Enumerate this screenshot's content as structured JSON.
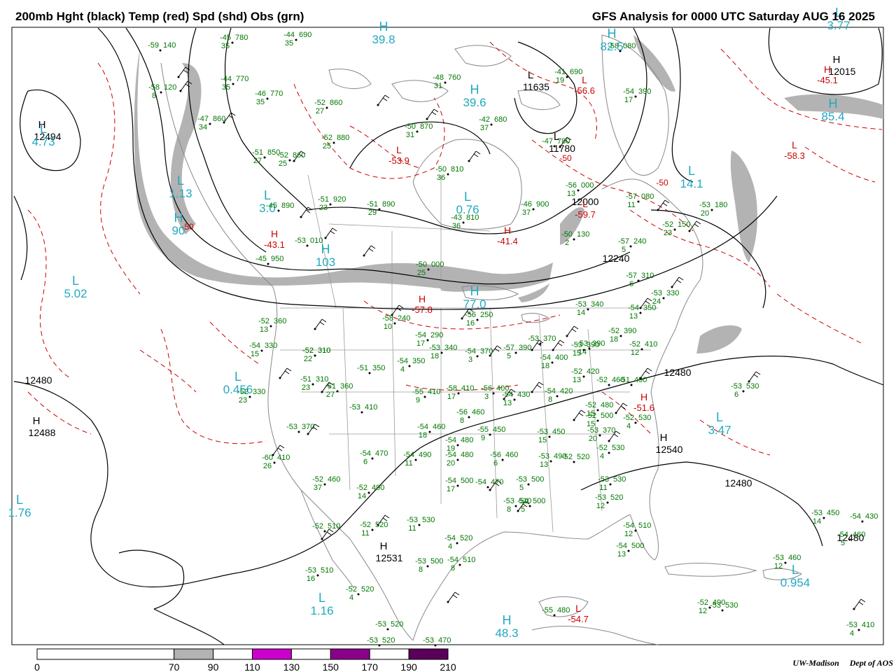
{
  "header": {
    "left_title": "200mb Hght (black) Temp (red) Spd (shd) Obs (grn)",
    "right_title": "GFS Analysis for 0000 UTC Saturday  AUG 16 2025"
  },
  "credit": {
    "left": "UW-Madison",
    "right": "Dept of AOS"
  },
  "colors": {
    "height_contour": "#000000",
    "temperature": "#cc0000",
    "observations": "#007700",
    "speed_label": "#22a9c0",
    "geography": "#888888",
    "shade_70_90": "#b3b3b3",
    "shade_110_130": "#cc00cc",
    "shade_150_170": "#8b008b",
    "shade_190_210": "#5a005a"
  },
  "colorbar": {
    "ticks": [
      "0",
      "70",
      "90",
      "110",
      "130",
      "150",
      "170",
      "190",
      "210"
    ],
    "segments": [
      {
        "from": 0,
        "to": 70,
        "color": "#ffffff"
      },
      {
        "from": 70,
        "to": 90,
        "color": "#b3b3b3"
      },
      {
        "from": 90,
        "to": 110,
        "color": "#ffffff"
      },
      {
        "from": 110,
        "to": 130,
        "color": "#cc00cc"
      },
      {
        "from": 130,
        "to": 150,
        "color": "#ffffff"
      },
      {
        "from": 150,
        "to": 170,
        "color": "#8b008b"
      },
      {
        "from": 170,
        "to": 190,
        "color": "#ffffff"
      },
      {
        "from": 190,
        "to": 210,
        "color": "#5a005a"
      }
    ]
  },
  "height_centers": [
    {
      "type": "H",
      "value": "12494"
    },
    {
      "type": "H",
      "value": "12488"
    },
    {
      "type": "H",
      "value": "12531"
    },
    {
      "type": "H",
      "value": "12540"
    },
    {
      "type": "H",
      "value": "12015"
    },
    {
      "type": "L",
      "value": "11635"
    },
    {
      "type": "L",
      "value": "11780"
    }
  ],
  "contour_labels": [
    "12480",
    "12480",
    "12480",
    "12240",
    "12000",
    "12480"
  ],
  "temp_centers": [
    {
      "type": "L",
      "value": "-53.9"
    },
    {
      "type": "L",
      "value": "-59.7"
    },
    {
      "type": "L",
      "value": "-56.6"
    },
    {
      "type": "L",
      "value": "-58.3"
    },
    {
      "type": "H",
      "value": "-43.1"
    },
    {
      "type": "H",
      "value": "-41.4"
    },
    {
      "type": "H",
      "value": "-45.1"
    },
    {
      "type": "H",
      "value": "-57.8"
    },
    {
      "type": "H",
      "value": "-51.6"
    },
    {
      "type": "L",
      "value": "-54.7"
    }
  ],
  "temp_contour_labels": [
    "-50",
    "-50",
    "-50"
  ],
  "speed_centers": [
    {
      "type": "L",
      "value": "4.73"
    },
    {
      "type": "L",
      "value": "5.02"
    },
    {
      "type": "L",
      "value": "0.456"
    },
    {
      "type": "L",
      "value": "1.16"
    },
    {
      "type": "L",
      "value": "3.47"
    },
    {
      "type": "L",
      "value": "14.1"
    },
    {
      "type": "L",
      "value": "0.954"
    },
    {
      "type": "H",
      "value": "39.8"
    },
    {
      "type": "H",
      "value": "39.6"
    },
    {
      "type": "H",
      "value": "82.5"
    },
    {
      "type": "H",
      "value": "85.4"
    },
    {
      "type": "H",
      "value": "77.0"
    },
    {
      "type": "H",
      "value": "48.3"
    },
    {
      "type": "H",
      "value": "90"
    },
    {
      "type": "L",
      "value": "3.77"
    },
    {
      "type": "L",
      "value": "1.76"
    },
    {
      "type": "L",
      "value": "1.13"
    },
    {
      "type": "L",
      "value": "3.0"
    },
    {
      "type": "L",
      "value": "0.76"
    },
    {
      "type": "H",
      "value": "103"
    }
  ],
  "observations": [
    {
      "temp": "-52",
      "hgt": "360",
      "spd": "13"
    },
    {
      "temp": "-54",
      "hgt": "330",
      "spd": "15"
    },
    {
      "temp": "-52",
      "hgt": "310",
      "spd": "22"
    },
    {
      "temp": "-52",
      "hgt": "310",
      "spd": ""
    },
    {
      "temp": "-51",
      "hgt": "310",
      "spd": "23"
    },
    {
      "temp": "-51",
      "hgt": "360",
      "spd": "27"
    },
    {
      "temp": "-52",
      "hgt": "330",
      "spd": "23"
    },
    {
      "temp": "-53",
      "hgt": "370",
      "spd": ""
    },
    {
      "temp": "-60",
      "hgt": "410",
      "spd": "26"
    },
    {
      "temp": "-52",
      "hgt": "460",
      "spd": "37"
    },
    {
      "temp": "-52",
      "hgt": "490",
      "spd": "14"
    },
    {
      "temp": "-52",
      "hgt": "510",
      "spd": ""
    },
    {
      "temp": "-53",
      "hgt": "510",
      "spd": "16"
    },
    {
      "temp": "-52",
      "hgt": "520",
      "spd": "4"
    },
    {
      "temp": "-53",
      "hgt": "520",
      "spd": ""
    },
    {
      "temp": "-52",
      "hgt": "520",
      "spd": "11"
    },
    {
      "temp": "-53",
      "hgt": "530",
      "spd": "11"
    },
    {
      "temp": "-54",
      "hgt": "520",
      "spd": "4"
    },
    {
      "temp": "-53",
      "hgt": "500",
      "spd": "8"
    },
    {
      "temp": "-54",
      "hgt": "510",
      "spd": "8"
    },
    {
      "temp": "-54",
      "hgt": "470",
      "spd": "6"
    },
    {
      "temp": "-53",
      "hgt": "410",
      "spd": ""
    },
    {
      "temp": "-54",
      "hgt": "350",
      "spd": "4"
    },
    {
      "temp": "-51",
      "hgt": "350",
      "spd": ""
    },
    {
      "temp": "-54",
      "hgt": "290",
      "spd": "17"
    },
    {
      "temp": "-53",
      "hgt": "340",
      "spd": "18"
    },
    {
      "temp": "-54",
      "hgt": "370",
      "spd": "3"
    },
    {
      "temp": "-57",
      "hgt": "390",
      "spd": "5"
    },
    {
      "temp": "-53",
      "hgt": "370",
      "spd": ""
    },
    {
      "temp": "-54",
      "hgt": "400",
      "spd": "18"
    },
    {
      "temp": "-53",
      "hgt": "390",
      "spd": "14"
    },
    {
      "temp": "-55",
      "hgt": "410",
      "spd": "9"
    },
    {
      "temp": "-58",
      "hgt": "410",
      "spd": "17"
    },
    {
      "temp": "-56",
      "hgt": "400",
      "spd": "3"
    },
    {
      "temp": "-54",
      "hgt": "430",
      "spd": "13"
    },
    {
      "temp": "-54",
      "hgt": "420",
      "spd": "8"
    },
    {
      "temp": "-52",
      "hgt": "420",
      "spd": "13"
    },
    {
      "temp": "-56",
      "hgt": "460",
      "spd": "8"
    },
    {
      "temp": "-54",
      "hgt": "460",
      "spd": "18"
    },
    {
      "temp": "-55",
      "hgt": "450",
      "spd": "9"
    },
    {
      "temp": "-54",
      "hgt": "490",
      "spd": "11"
    },
    {
      "temp": "-54",
      "hgt": "480",
      "spd": "19"
    },
    {
      "temp": "-54",
      "hgt": "480",
      "spd": "20"
    },
    {
      "temp": "-56",
      "hgt": "460",
      "spd": "6"
    },
    {
      "temp": "-53",
      "hgt": "450",
      "spd": "15"
    },
    {
      "temp": "-53",
      "hgt": "500",
      "spd": "5"
    },
    {
      "temp": "-52",
      "hgt": "520",
      "spd": ""
    },
    {
      "temp": "-54",
      "hgt": "500",
      "spd": "17"
    },
    {
      "temp": "-54",
      "hgt": "470",
      "spd": ""
    },
    {
      "temp": "-53",
      "hgt": "490",
      "spd": "13"
    },
    {
      "temp": "-53",
      "hgt": "510",
      "spd": "8"
    },
    {
      "temp": "-54",
      "hgt": "500",
      "spd": "5"
    },
    {
      "temp": "-52",
      "hgt": "530",
      "spd": "4"
    },
    {
      "temp": "-53",
      "hgt": "530",
      "spd": "11"
    },
    {
      "temp": "-53",
      "hgt": "520",
      "spd": "12"
    },
    {
      "temp": "-54",
      "hgt": "510",
      "spd": "12"
    },
    {
      "temp": "-54",
      "hgt": "500",
      "spd": "13"
    },
    {
      "temp": "-52",
      "hgt": "480",
      "spd": "15"
    },
    {
      "temp": "-52",
      "hgt": "500",
      "spd": "15"
    },
    {
      "temp": "-52",
      "hgt": "530",
      "spd": "4"
    },
    {
      "temp": "-51",
      "hgt": "490",
      "spd": ""
    },
    {
      "temp": "-52",
      "hgt": "460",
      "spd": ""
    },
    {
      "temp": "-52",
      "hgt": "410",
      "spd": "12"
    },
    {
      "temp": "-52",
      "hgt": "390",
      "spd": "18"
    },
    {
      "temp": "-53",
      "hgt": "390",
      "spd": "15"
    },
    {
      "temp": "-53",
      "hgt": "340",
      "spd": "14"
    },
    {
      "temp": "-54",
      "hgt": "350",
      "spd": "13"
    },
    {
      "temp": "-53",
      "hgt": "330",
      "spd": "24"
    },
    {
      "temp": "-57",
      "hgt": "310",
      "spd": "6"
    },
    {
      "temp": "-57",
      "hgt": "240",
      "spd": "5"
    },
    {
      "temp": "-52",
      "hgt": "150",
      "spd": "23"
    },
    {
      "temp": "-57",
      "hgt": "080",
      "spd": "11"
    },
    {
      "temp": "-53",
      "hgt": "180",
      "spd": "20"
    },
    {
      "temp": "-53",
      "hgt": "530",
      "spd": "6"
    },
    {
      "temp": "-50",
      "hgt": "130",
      "spd": "2"
    },
    {
      "temp": "-56",
      "hgt": "000",
      "spd": "13"
    },
    {
      "temp": "-46",
      "hgt": "900",
      "spd": "37"
    },
    {
      "temp": "-43",
      "hgt": "810",
      "spd": "36"
    },
    {
      "temp": "-51",
      "hgt": "890",
      "spd": "29"
    },
    {
      "temp": "-51",
      "hgt": "920",
      "spd": "23"
    },
    {
      "temp": "-50",
      "hgt": "000",
      "spd": "25"
    },
    {
      "temp": "-56",
      "hgt": "250",
      "spd": "16"
    },
    {
      "temp": "-58",
      "hgt": "240",
      "spd": "10"
    },
    {
      "temp": "-53",
      "hgt": "010",
      "spd": ""
    },
    {
      "temp": "-45",
      "hgt": "950",
      "spd": ""
    },
    {
      "temp": "-45",
      "hgt": "890",
      "spd": ""
    },
    {
      "temp": "-51",
      "hgt": "850",
      "spd": "27"
    },
    {
      "temp": "-52",
      "hgt": "860",
      "spd": "25"
    },
    {
      "temp": "-47",
      "hgt": "860",
      "spd": "34"
    },
    {
      "temp": "-46",
      "hgt": "770",
      "spd": "35"
    },
    {
      "temp": "-44",
      "hgt": "770",
      "spd": "35"
    },
    {
      "temp": "-45",
      "hgt": "780",
      "spd": "35"
    },
    {
      "temp": "-44",
      "hgt": "690",
      "spd": "35"
    },
    {
      "temp": "-59",
      "hgt": "140",
      "spd": ""
    },
    {
      "temp": "-58",
      "hgt": "120",
      "spd": "8"
    },
    {
      "temp": "-52",
      "hgt": "860",
      "spd": "27"
    },
    {
      "temp": "-52",
      "hgt": "880",
      "spd": "25"
    },
    {
      "temp": "-50",
      "hgt": "810",
      "spd": "36"
    },
    {
      "temp": "-50",
      "hgt": "870",
      "spd": "31"
    },
    {
      "temp": "-48",
      "hgt": "760",
      "spd": "31"
    },
    {
      "temp": "-42",
      "hgt": "680",
      "spd": "37"
    },
    {
      "temp": "-41",
      "hgt": "690",
      "spd": "19"
    },
    {
      "temp": "-54",
      "hgt": "390",
      "spd": "17"
    },
    {
      "temp": "-58",
      "hgt": "080",
      "spd": ""
    },
    {
      "temp": "-47",
      "hgt": "780",
      "spd": ""
    },
    {
      "temp": "-54",
      "hgt": "460",
      "spd": "5"
    },
    {
      "temp": "-53",
      "hgt": "460",
      "spd": "12"
    },
    {
      "temp": "-53",
      "hgt": "450",
      "spd": "14"
    },
    {
      "temp": "-55",
      "hgt": "480",
      "spd": ""
    },
    {
      "temp": "-53",
      "hgt": "410",
      "spd": "4"
    },
    {
      "temp": "-52",
      "hgt": "490",
      "spd": "12"
    },
    {
      "temp": "-54",
      "hgt": "430",
      "spd": ""
    },
    {
      "temp": "-53",
      "hgt": "470",
      "spd": ""
    },
    {
      "temp": "-53",
      "hgt": "520",
      "spd": ""
    },
    {
      "temp": "-53",
      "hgt": "530",
      "spd": ""
    },
    {
      "temp": "-53",
      "hgt": "370",
      "spd": "20"
    }
  ]
}
